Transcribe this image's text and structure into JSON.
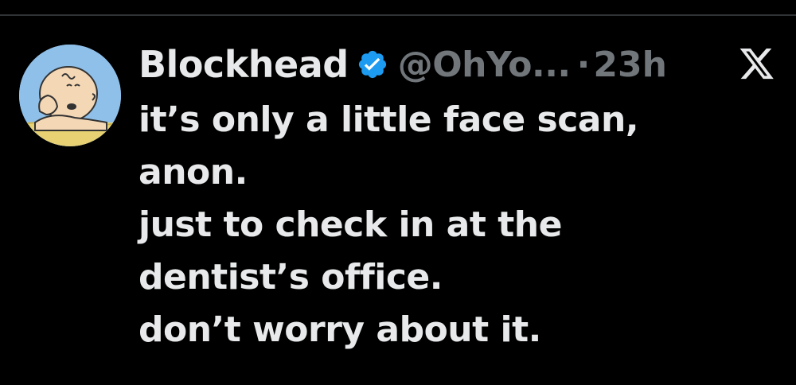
{
  "tweet": {
    "author_name": "Blockhead",
    "handle": "@OhYo...",
    "separator": "·",
    "time": "23h",
    "lines": [
      "it’s only a little face scan,",
      "anon.",
      "just to check in at the",
      "dentist’s office.",
      "don’t worry about it."
    ]
  },
  "icons": {
    "avatar": "charlie-brown-avatar",
    "verified": "verified-badge-icon",
    "platform": "x-logo-icon"
  },
  "colors": {
    "background": "#000000",
    "primary_text": "#e7e9ea",
    "secondary_text": "#71767b",
    "verified": "#1d9bf0",
    "divider": "#2f3336"
  }
}
